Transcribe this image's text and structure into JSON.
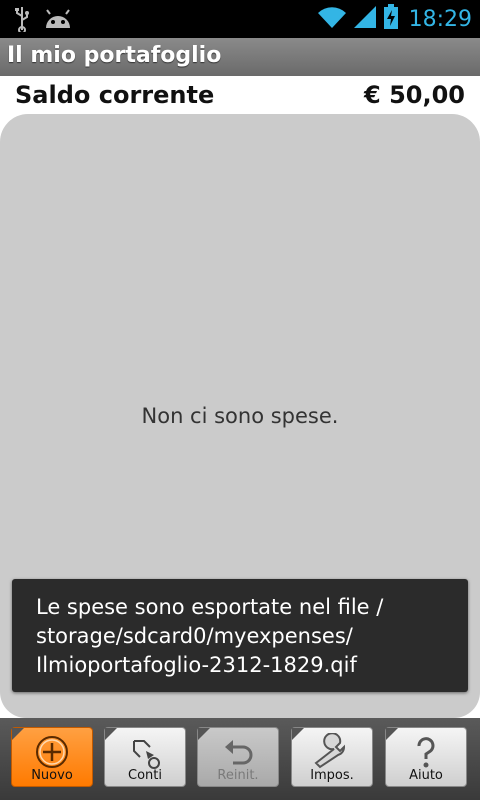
{
  "status_bar": {
    "time": "18:29"
  },
  "app": {
    "title": "Il mio portafoglio"
  },
  "balance": {
    "label": "Saldo corrente",
    "value": "€ 50,00"
  },
  "expenses": {
    "empty_message": "Non ci sono spese."
  },
  "toast": {
    "lines": [
      "Le spese sono esportate nel file /",
      "storage/sdcard0/myexpenses/",
      "Ilmioportafoglio-2312-1829.qif"
    ]
  },
  "toolbar": {
    "buttons": [
      {
        "label": "Nuovo",
        "icon": "plus-circle-icon",
        "state": "active"
      },
      {
        "label": "Conti",
        "icon": "accounts-icon",
        "state": "normal"
      },
      {
        "label": "Reinit.",
        "icon": "undo-icon",
        "state": "disabled"
      },
      {
        "label": "Impos.",
        "icon": "wrench-icon",
        "state": "normal"
      },
      {
        "label": "Aiuto",
        "icon": "help-icon",
        "state": "normal"
      }
    ]
  },
  "colors": {
    "accent_orange": "#ff7a00",
    "clock_blue": "#33b5e5",
    "panel_grey": "#cbcbcb"
  }
}
